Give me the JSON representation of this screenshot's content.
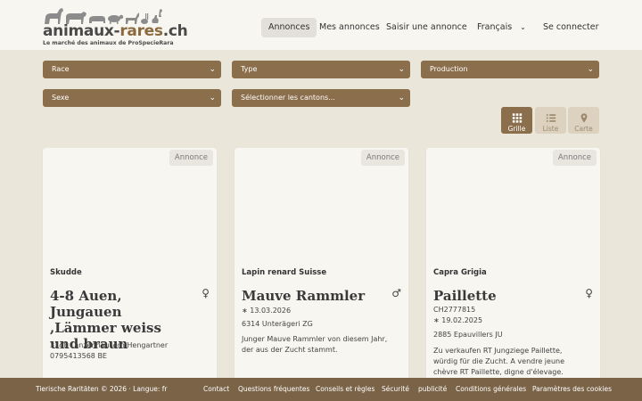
{
  "header": {
    "logo_text_main": "animaux-",
    "logo_text_accent": "rares",
    "logo_text_tld": ".ch",
    "logo_subtitle": "Le marché des animaux de ProSpecieRara",
    "nav": {
      "annonces": "Annonces",
      "mes_annonces": "Mes annonces",
      "saisir": "Saisir une annonce",
      "langue": "Français",
      "connexion": "Se connecter"
    }
  },
  "filters": {
    "race": "Race",
    "type": "Type",
    "production": "Production",
    "sexe": "Sexe",
    "cantons": "Sélectionner les cantons..."
  },
  "view": {
    "grille": "Grille",
    "liste": "Liste",
    "carte": "Carte"
  },
  "cards": [
    {
      "badge": "Annonce",
      "breed": "Skudde",
      "title": "4-8 Auen, Jungauen ,Lämmer weiss und braun",
      "sex_symbol": "♀",
      "location": "3148 Lanzenhäusern Hengartner 0795413568 BE"
    },
    {
      "badge": "Annonce",
      "breed": "Lapin renard Suisse",
      "title": "Mauve Rammler",
      "sex_symbol": "♂",
      "birth": "∗ 13.03.2026",
      "location": "6314 Unterägeri ZG",
      "description": "Junger Mauve Rammler von diesem Jahr, der aus der Zucht stammt."
    },
    {
      "badge": "Annonce",
      "breed": "Capra Grigia",
      "title": "Paillette",
      "sex_symbol": "♀",
      "id": "CH2777815",
      "birth": "∗ 19.02.2025",
      "location": "2885 Epauvillers JU",
      "description": "Zu verkaufen RT Jungziege Paillette, würdig für die Zucht. A vendre jeune chèvre RT Paillette, digne d'élevage."
    }
  ],
  "footer": {
    "copyright": "Tierische Raritäten © 2026 · Langue: fr",
    "links": [
      "Contact",
      "Questions fréquentes",
      "Conseils et règles",
      "Sécurité",
      "publicité",
      "Conditions générales",
      "Paramètres des cookies"
    ]
  },
  "colors": {
    "brand_brown": "#8b6e4b",
    "background": "#ebe6da",
    "footer": "#7a6347"
  }
}
